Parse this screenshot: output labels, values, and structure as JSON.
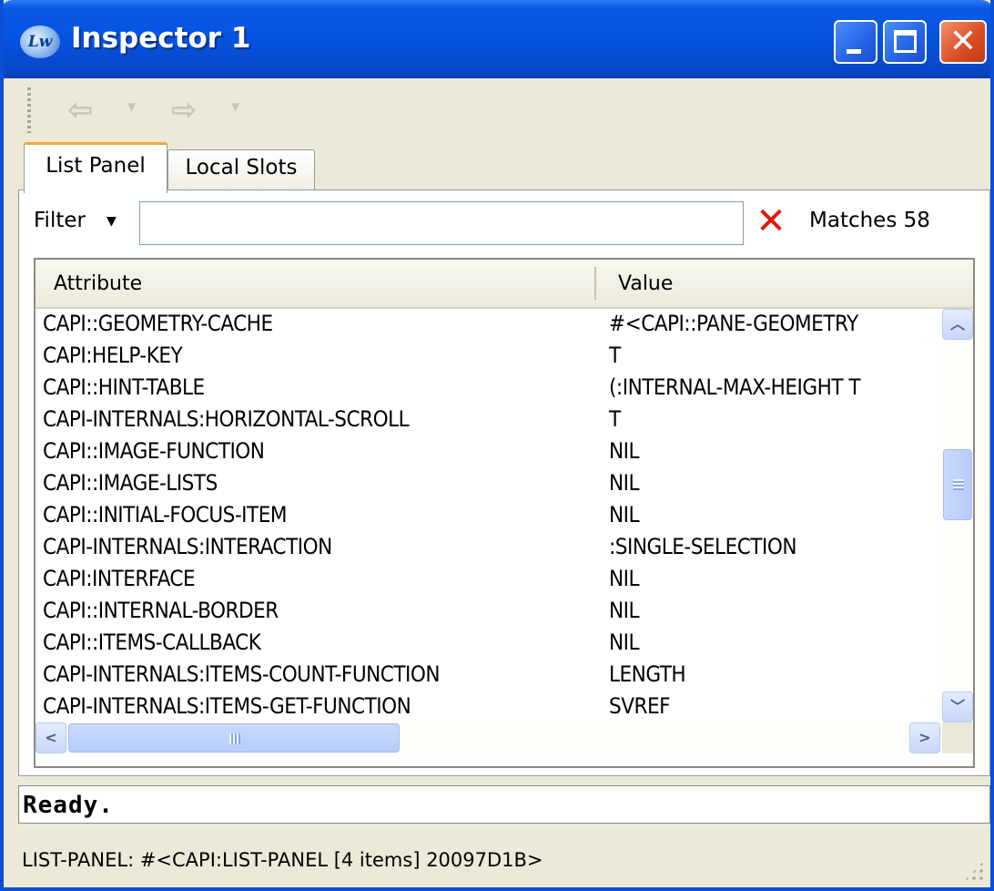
{
  "window": {
    "title": "Inspector 1",
    "app_icon": "lw-icon",
    "accent": "#0a5ae6"
  },
  "toolbar": {
    "back_icon": "back-arrow-icon",
    "forward_icon": "forward-arrow-icon"
  },
  "tabs": [
    {
      "label": "List Panel",
      "active": true
    },
    {
      "label": "Local Slots",
      "active": false
    }
  ],
  "filter": {
    "label": "Filter",
    "value": "",
    "matches": "Matches 58"
  },
  "table": {
    "columns": [
      "Attribute",
      "Value"
    ],
    "rows": [
      {
        "attribute": "CAPI::GEOMETRY-CACHE",
        "value": "#<CAPI::PANE-GEOMETRY"
      },
      {
        "attribute": "CAPI:HELP-KEY",
        "value": "T"
      },
      {
        "attribute": "CAPI::HINT-TABLE",
        "value": "(:INTERNAL-MAX-HEIGHT T"
      },
      {
        "attribute": "CAPI-INTERNALS:HORIZONTAL-SCROLL",
        "value": "T"
      },
      {
        "attribute": "CAPI::IMAGE-FUNCTION",
        "value": "NIL"
      },
      {
        "attribute": "CAPI::IMAGE-LISTS",
        "value": "NIL"
      },
      {
        "attribute": "CAPI::INITIAL-FOCUS-ITEM",
        "value": "NIL"
      },
      {
        "attribute": "CAPI-INTERNALS:INTERACTION",
        "value": ":SINGLE-SELECTION"
      },
      {
        "attribute": "CAPI:INTERFACE",
        "value": "NIL"
      },
      {
        "attribute": "CAPI::INTERNAL-BORDER",
        "value": "NIL"
      },
      {
        "attribute": "CAPI::ITEMS-CALLBACK",
        "value": "NIL"
      },
      {
        "attribute": "CAPI-INTERNALS:ITEMS-COUNT-FUNCTION",
        "value": "LENGTH"
      },
      {
        "attribute": "CAPI-INTERNALS:ITEMS-GET-FUNCTION",
        "value": "SVREF"
      }
    ]
  },
  "echo_area": {
    "text": "Ready."
  },
  "status": {
    "text": "LIST-PANEL: #<CAPI:LIST-PANEL [4 items] 20097D1B>"
  }
}
